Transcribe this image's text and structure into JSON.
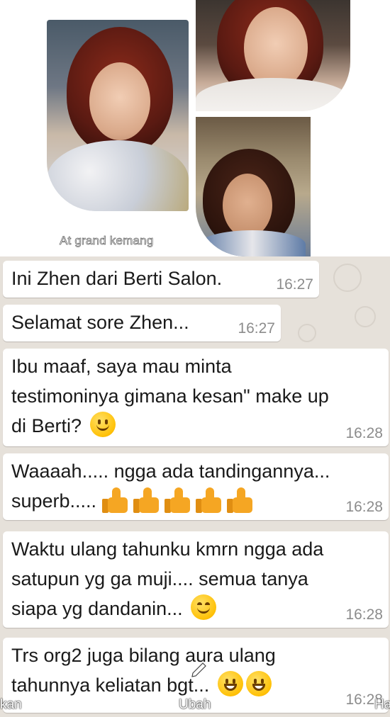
{
  "collage": {
    "caption": "At grand kemang"
  },
  "chat": {
    "messages": [
      {
        "text": "Ini Zhen dari Berti Salon.",
        "time": "16:27"
      },
      {
        "text": "Selamat sore Zhen...",
        "time": "16:27"
      },
      {
        "lines": [
          "Ibu maaf, saya mau minta",
          "testimoninya gimana kesan\" make up",
          "di Berti?"
        ],
        "emoji": "slightly-smiling-face",
        "time": "16:28"
      },
      {
        "lines": [
          "Waaaah..... ngga ada tandingannya...",
          "superb....."
        ],
        "emoji": "thumbs-up x5",
        "time": "16:28"
      },
      {
        "lines": [
          "Waktu ulang tahunku kmrn ngga ada",
          "satupun yg ga muji.... semua tanya",
          "siapa yg dandanin..."
        ],
        "emoji": "smiling-face-with-smiling-eyes",
        "time": "16:28"
      },
      {
        "lines": [
          "Trs org2 juga bilang aura ulang",
          "tahunnya keliatan bgt..."
        ],
        "emoji": "grinning-face x2",
        "time": "16:28"
      }
    ]
  },
  "toolbar": {
    "left_label": "kan",
    "center_label": "Ubah",
    "right_label": "Ha"
  },
  "colors": {
    "chat_background": "#e6e1da",
    "bubble": "#ffffff",
    "timestamp": "#8c8c8c"
  }
}
